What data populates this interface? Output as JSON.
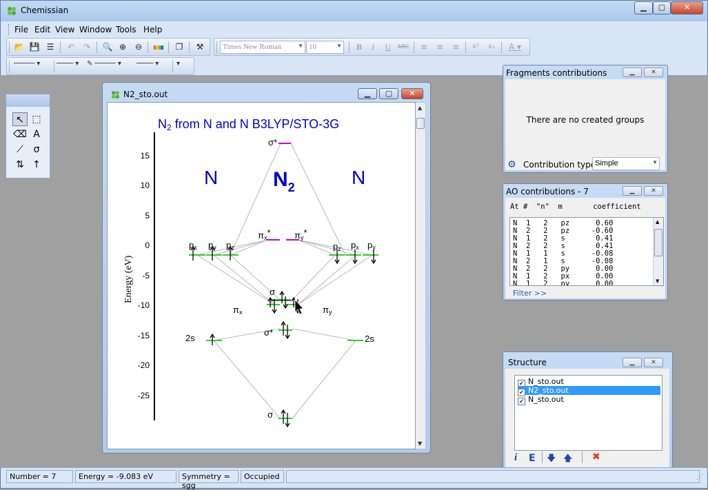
{
  "app": {
    "title": "Chemissian"
  },
  "window_controls": {
    "minimize": "▁",
    "maximize": "▢",
    "close": "✕"
  },
  "menu": [
    "File",
    "Edit",
    "View",
    "Window",
    "Tools",
    "Help"
  ],
  "toolbar": {
    "font_combo": "Times New Roman",
    "size_combo": "10",
    "format_labels": [
      "B",
      "I",
      "U",
      "ABC"
    ]
  },
  "document": {
    "title": "N2_sto.out",
    "diagram": {
      "title_prefix": "N",
      "title_sub": "2",
      "title_rest": " from N and N  B3LYP/STO-3G",
      "left_label": "N",
      "center_label": "N",
      "center_sub": "2",
      "right_label": "N",
      "y_axis_label": "Energy (eV)",
      "y_ticks": [
        "15",
        "10",
        "5",
        "0",
        "-5",
        "-10",
        "-15",
        "-20",
        "-25"
      ],
      "orbital_labels": {
        "sigma_star_top": "σ*",
        "pi_x_star": "π",
        "pi_x_star_sub": "x",
        "pi_x_star_sup": "*",
        "pi_y_star": "π",
        "pi_y_star_sub": "y",
        "pi_y_star_sup": "*",
        "left_px": "p",
        "left_px_sub": "x",
        "left_py": "p",
        "left_py_sub": "y",
        "left_pz": "p",
        "left_pz_sub": "z",
        "right_pz": "p",
        "right_pz_sub": "z",
        "right_px": "p",
        "right_px_sub": "x",
        "right_py": "p",
        "right_py_sub": "y",
        "sigma_mid": "σ",
        "pi_x": "π",
        "pi_x_sub": "x",
        "pi_y": "π",
        "pi_y_sub": "y",
        "left_2s": "2s",
        "right_2s": "2s",
        "sigma_star_2s": "σ*",
        "sigma_bottom": "σ"
      }
    }
  },
  "fragments_panel": {
    "title": "Fragments contributions",
    "message": "There are no created groups",
    "contribution_type_label": "Contribution type:",
    "contribution_type_value": "Simple"
  },
  "ao_panel": {
    "title": "AO contributions - 7",
    "header": "At #  \"n\"  m       coefficient",
    "rows": [
      "N  1   2   pz      0.60",
      "N  2   2   pz     -0.60",
      "N  1   2   s       0.41",
      "N  2   2   s       0.41",
      "N  1   1   s      -0.08",
      "N  2   1   s      -0.08",
      "N  2   2   py      0.00",
      "N  1   2   px      0.00",
      "N  1   2   py      0.00"
    ],
    "filter_label": "Filter >>"
  },
  "structure_panel": {
    "title": "Structure",
    "items": [
      {
        "label": "N_sto.out",
        "checked": true,
        "selected": false
      },
      {
        "label": "N2_sto.out",
        "checked": true,
        "selected": true
      },
      {
        "label": "N_sto.out",
        "checked": true,
        "selected": false
      }
    ],
    "toolbar": {
      "info": "i",
      "energy": "E",
      "down": "🡇",
      "up": "🡅",
      "delete": "✖"
    }
  },
  "status": {
    "number": "Number = 7",
    "energy": "Energy = -9.083 eV",
    "symmetry": "Symmetry = sgg",
    "occupancy": "Occupied"
  },
  "colors": {
    "accent": "#3399ff",
    "title_blue": "#0000cc",
    "level_green": "#33cc33",
    "level_magenta": "#cc00cc",
    "close_red": "#e03a1e"
  }
}
